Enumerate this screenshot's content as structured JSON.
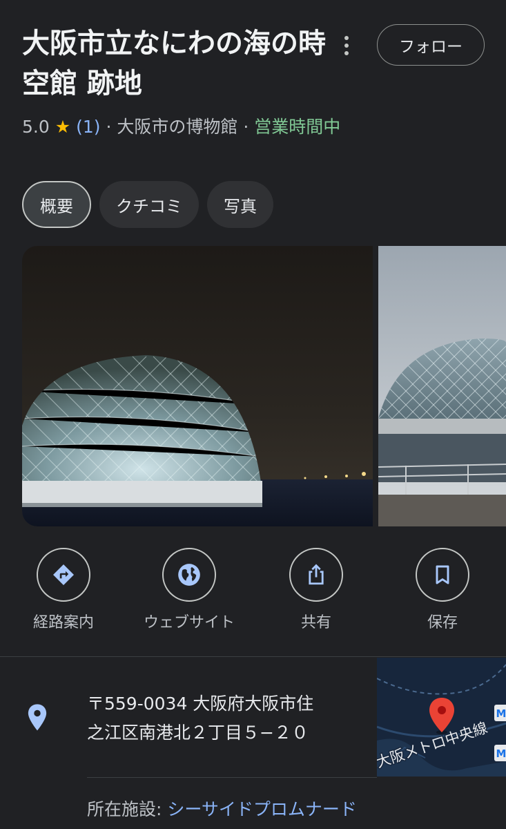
{
  "place": {
    "title": "大阪市立なにわの海の時空館 跡地",
    "follow_label": "フォロー",
    "rating": "5.0",
    "rating_count": "(1)",
    "separator": "·",
    "category": "大阪市の博物館",
    "status": "営業時間中"
  },
  "tabs": [
    {
      "label": "概要",
      "active": true
    },
    {
      "label": "クチコミ",
      "active": false
    },
    {
      "label": "写真",
      "active": false
    }
  ],
  "actions": [
    {
      "label": "経路案内",
      "icon": "directions-icon"
    },
    {
      "label": "ウェブサイト",
      "icon": "globe-icon"
    },
    {
      "label": "共有",
      "icon": "share-icon"
    },
    {
      "label": "保存",
      "icon": "bookmark-icon"
    }
  ],
  "address": {
    "line1": "〒559-0034 大阪府大阪市住",
    "line2": "之江区南港北２丁目５−２０"
  },
  "map": {
    "line_label": "大阪メトロ中央線",
    "badge": "M"
  },
  "facility": {
    "label": "所在施設: ",
    "link": "シーサイドプロムナード"
  },
  "colors": {
    "background": "#202124",
    "accent_blue": "#8ab4f8",
    "open_green": "#81c995",
    "star": "#fbbc04",
    "pin_red": "#ea4335"
  }
}
